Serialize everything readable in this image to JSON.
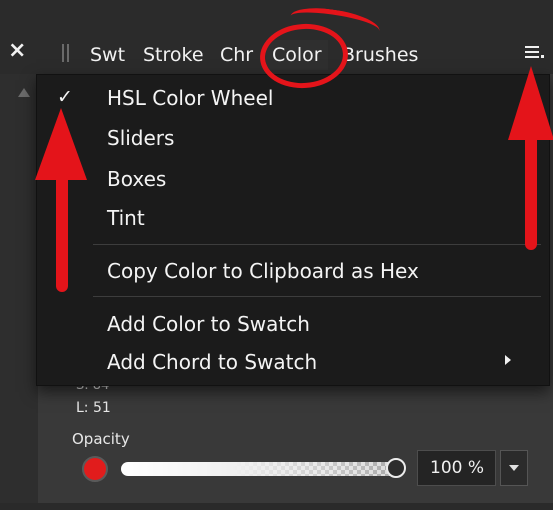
{
  "panel": {
    "close_glyph": "×",
    "tabs": [
      "Swt",
      "Stroke",
      "Chr",
      "Color",
      "Brushes"
    ],
    "active_tab": "Color",
    "menu_icon": "hamburger-menu-icon"
  },
  "dropdown": {
    "items": [
      {
        "label": "HSL Color Wheel",
        "checked": true
      },
      {
        "label": "Sliders"
      },
      {
        "label": "Boxes"
      },
      {
        "label": "Tint"
      },
      {
        "label": "Copy Color to Clipboard as Hex"
      },
      {
        "label": "Add Color to Swatch"
      },
      {
        "label": "Add Chord to Swatch",
        "has_submenu": true
      }
    ],
    "check_glyph": "✓"
  },
  "hsl": {
    "s_label": "S: 84",
    "l_label": "L: 51"
  },
  "opacity": {
    "label": "Opacity",
    "value_text": "100 %",
    "level": 1.0,
    "swatch_color": "#e11c1c"
  },
  "colors": {
    "annotation_red": "#e4141a",
    "menu_bg": "#1b1b1b",
    "panel_bg": "#393939"
  }
}
